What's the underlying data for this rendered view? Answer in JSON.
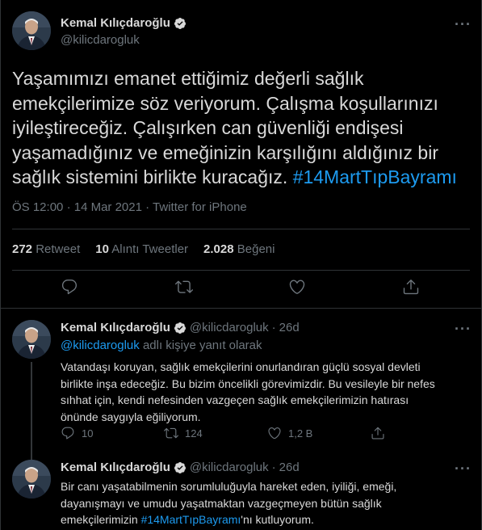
{
  "colors": {
    "background": "#000000",
    "text": "#d9d9d9",
    "muted": "#6e767d",
    "accent": "#1d9bf0",
    "border": "#2f3336"
  },
  "main_tweet": {
    "author_name": "Kemal Kılıçdaroğlu",
    "handle": "@kilicdarogluk",
    "more_icon": "more-icon",
    "text": "Yaşamımızı emanet ettiğimiz değerli sağlık emekçilerimize söz veriyorum. Çalışma koşullarınızı iyileştireceğiz. Çalışırken can güvenliği endişesi yaşamadığınız ve emeğinizin karşılığını aldığınız bir sağlık sistemini birlikte kuracağız.",
    "hashtag": "#14MartTıpBayramı",
    "time": "ÖS 12:00",
    "date": "14 Mar 2021",
    "source": "Twitter for iPhone",
    "stats": {
      "retweets": "272",
      "retweets_label": "Retweet",
      "quotes": "10",
      "quotes_label": "Alıntı Tweetler",
      "likes": "2.028",
      "likes_label": "Beğeni"
    },
    "actions": [
      "reply-icon",
      "retweet-icon",
      "like-icon",
      "share-icon"
    ]
  },
  "replies": [
    {
      "author_name": "Kemal Kılıçdaroğlu",
      "handle": "@kilicdarogluk",
      "age": "26d",
      "replying_mention": "@kilicdarogluk",
      "replying_suffix": "adlı kişiye yanıt olarak",
      "text": "Vatandaşı koruyan, sağlık emekçilerini onurlandıran güçlü sosyal devleti birlikte inşa edeceğiz. Bu bizim öncelikli görevimizdir. Bu vesileyle bir nefes sıhhat için, kendi nefesinden vazgeçen sağlık emekçilerimizin hatırası önünde saygıyla eğiliyorum.",
      "reply_count": "10",
      "retweet_count": "124",
      "like_count": "1,2 B"
    },
    {
      "author_name": "Kemal Kılıçdaroğlu",
      "handle": "@kilicdarogluk",
      "age": "26d",
      "text_before": "Bir canı yaşatabilmenin sorumluluğuyla hareket eden, iyiliği, emeği, dayanışmayı ve umudu yaşatmaktan vazgeçmeyen bütün sağlık emekçilerimizin ",
      "hashtag": "#14MartTıpBayramı",
      "text_after": "'nı kutluyorum."
    }
  ]
}
